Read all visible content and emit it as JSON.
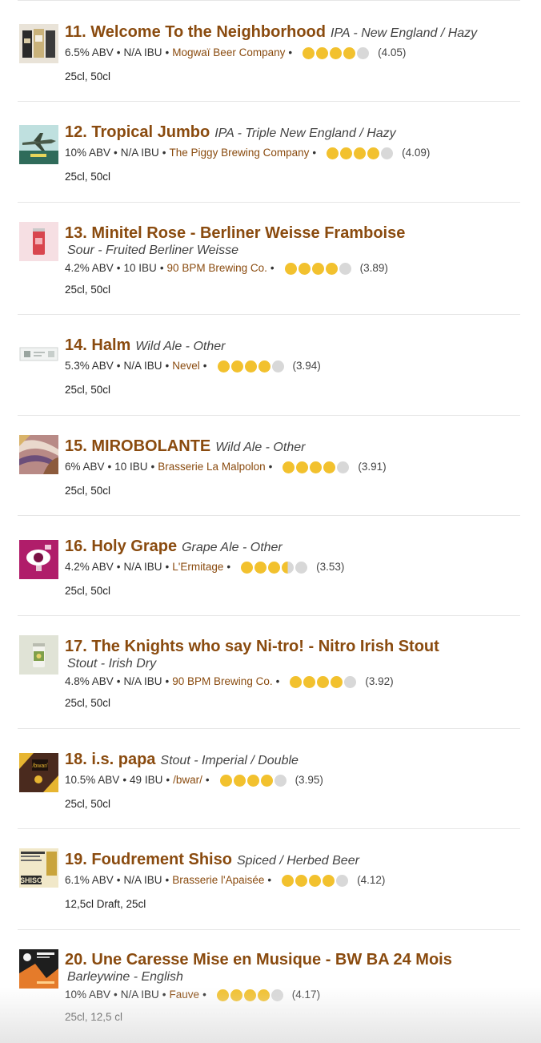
{
  "colors": {
    "link": "#8a4b0f",
    "cap_full": "#f2c12e",
    "cap_empty": "#d8d8d8"
  },
  "items": [
    {
      "num": "11.",
      "name": "Welcome To the Neighborhood",
      "style": "IPA - New England / Hazy",
      "style_wrap": false,
      "abv": "6.5% ABV",
      "ibu": "N/A IBU",
      "brewery": "Mogwaï Beer Company",
      "rating": 4.05,
      "score": "(4.05)",
      "sizes": "25cl, 50cl",
      "thumb_icon": "beer-cans-label-icon"
    },
    {
      "num": "12.",
      "name": "Tropical Jumbo",
      "style": "IPA - Triple New England / Hazy",
      "style_wrap": false,
      "abv": "10% ABV",
      "ibu": "N/A IBU",
      "brewery": "The Piggy Brewing Company",
      "rating": 4.09,
      "score": "(4.09)",
      "sizes": "25cl, 50cl",
      "thumb_icon": "airplane-label-icon"
    },
    {
      "num": "13.",
      "name": "Minitel Rose - Berliner Weisse Framboise",
      "style": "Sour - Fruited Berliner Weisse",
      "style_wrap": true,
      "abv": "4.2% ABV",
      "ibu": "10 IBU",
      "brewery": "90 BPM Brewing Co.",
      "rating": 3.89,
      "score": "(3.89)",
      "sizes": "25cl, 50cl",
      "thumb_icon": "pink-can-icon"
    },
    {
      "num": "14.",
      "name": "Halm",
      "style": "Wild Ale - Other",
      "style_wrap": false,
      "abv": "5.3% ABV",
      "ibu": "N/A IBU",
      "brewery": "Nevel",
      "rating": 3.94,
      "score": "(3.94)",
      "sizes": "25cl, 50cl",
      "thumb_icon": "white-label-icon"
    },
    {
      "num": "15.",
      "name": "MIROBOLANTE",
      "style": "Wild Ale - Other",
      "style_wrap": false,
      "abv": "6% ABV",
      "ibu": "10 IBU",
      "brewery": "Brasserie La Malpolon",
      "rating": 3.91,
      "score": "(3.91)",
      "sizes": "25cl, 50cl",
      "thumb_icon": "abstract-art-icon"
    },
    {
      "num": "16.",
      "name": "Holy Grape",
      "style": "Grape Ale - Other",
      "style_wrap": false,
      "abv": "4.2% ABV",
      "ibu": "N/A IBU",
      "brewery": "L'Ermitage",
      "rating": 3.53,
      "score": "(3.53)",
      "sizes": "25cl, 50cl",
      "thumb_icon": "grape-logo-icon"
    },
    {
      "num": "17.",
      "name": "The Knights who say Ni-tro! - Nitro Irish Stout",
      "style": "Stout - Irish Dry",
      "style_wrap": true,
      "abv": "4.8% ABV",
      "ibu": "N/A IBU",
      "brewery": "90 BPM Brewing Co.",
      "rating": 3.92,
      "score": "(3.92)",
      "sizes": "25cl, 50cl",
      "thumb_icon": "green-can-icon"
    },
    {
      "num": "18.",
      "name": "i.s. papa",
      "style": "Stout - Imperial / Double",
      "style_wrap": false,
      "abv": "10.5% ABV",
      "ibu": "49 IBU",
      "brewery": "/bwar/",
      "rating": 3.95,
      "score": "(3.95)",
      "sizes": "25cl, 50cl",
      "thumb_icon": "bwar-logo-icon"
    },
    {
      "num": "19.",
      "name": "Foudrement Shiso",
      "style": "Spiced / Herbed Beer",
      "style_wrap": false,
      "abv": "6.1% ABV",
      "ibu": "N/A IBU",
      "brewery": "Brasserie l'Apaisée",
      "rating": 4.12,
      "score": "(4.12)",
      "sizes": "12,5cl Draft, 25cl",
      "thumb_icon": "shiso-label-icon"
    },
    {
      "num": "20.",
      "name": "Une Caresse Mise en Musique - BW BA 24 Mois",
      "style": "Barleywine - English",
      "style_wrap": true,
      "abv": "10% ABV",
      "ibu": "N/A IBU",
      "brewery": "Fauve",
      "rating": 4.17,
      "score": "(4.17)",
      "sizes": "25cl, 12,5 cl",
      "thumb_icon": "fauve-label-icon"
    }
  ]
}
